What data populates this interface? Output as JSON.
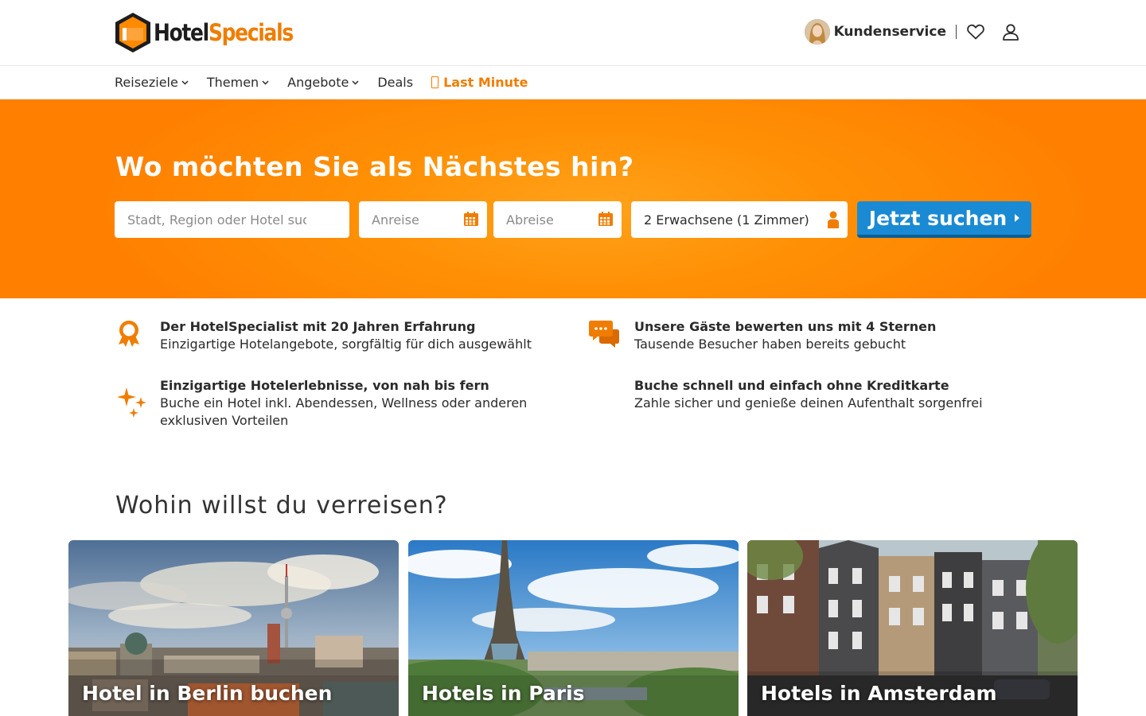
{
  "brand": {
    "part1": "Hotel",
    "part2": "Specials"
  },
  "header": {
    "customer_service": "Kundenservice"
  },
  "nav": {
    "items": [
      {
        "label": "Reiseziele",
        "has_dropdown": true
      },
      {
        "label": "Themen",
        "has_dropdown": true
      },
      {
        "label": "Angebote",
        "has_dropdown": true
      },
      {
        "label": "Deals",
        "has_dropdown": false
      }
    ],
    "last_minute": "Last Minute"
  },
  "hero": {
    "title": "Wo möchten Sie als Nächstes hin?",
    "destination_placeholder": "Stadt, Region oder Hotel suchen",
    "checkin_placeholder": "Anreise",
    "checkout_placeholder": "Abreise",
    "guests_value": "2 Erwachsene (1 Zimmer)",
    "search_button": "Jetzt suchen"
  },
  "usps": [
    {
      "title": "Der HotelSpecialist mit 20 Jahren Erfahrung",
      "desc": "Einzigartige Hotelangebote, sorgfältig für dich ausgewählt",
      "icon": "award-icon"
    },
    {
      "title": "Unsere Gäste bewerten uns mit 4 Sternen",
      "desc": "Tausende Besucher haben bereits gebucht",
      "icon": "chat-bubbles-icon"
    },
    {
      "title": "Einzigartige Hotelerlebnisse, von nah bis fern",
      "desc": "Buche ein Hotel inkl. Abendessen, Wellness oder anderen exklusiven Vorteilen",
      "icon": "sparkles-icon"
    },
    {
      "title": "Buche schnell und einfach ohne Kreditkarte",
      "desc": "Zahle sicher und genieße deinen Aufenthalt sorgenfrei",
      "icon": ""
    }
  ],
  "destinations": {
    "title": "Wohin willst du verreisen?",
    "cards": [
      {
        "label": "Hotel in Berlin buchen"
      },
      {
        "label": "Hotels in Paris"
      },
      {
        "label": "Hotels in Amsterdam"
      }
    ]
  },
  "colors": {
    "brand_orange": "#f07d00",
    "hero_orange": "#ff8a00",
    "button_blue": "#1a8ad4"
  }
}
